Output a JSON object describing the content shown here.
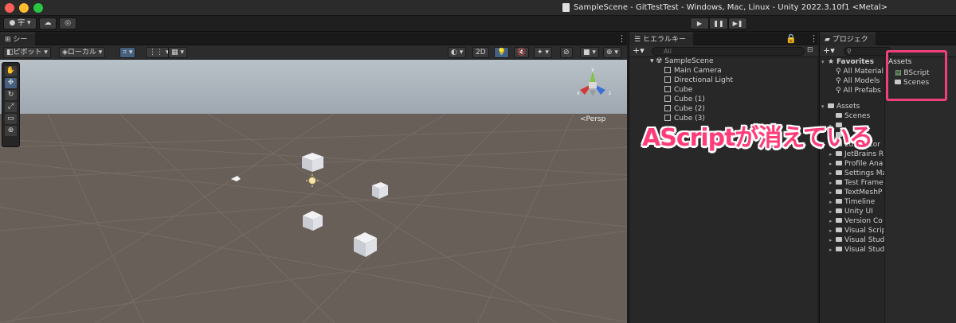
{
  "window": {
    "title": "SampleScene - GitTestTest - Windows, Mac, Linux - Unity 2022.3.10f1 <Metal>"
  },
  "toolbar": {
    "account_label": "宇 ▾",
    "play_icon": "play-icon",
    "pause_icon": "pause-icon",
    "step_icon": "step-icon"
  },
  "scene": {
    "tab_label": "シーン",
    "pivot_label": "ピボット",
    "local_label": "ローカル",
    "mode_2d": "2D",
    "persp_label": "<Persp",
    "gizmo_axes": [
      "x",
      "y",
      "z"
    ]
  },
  "hierarchy": {
    "tab_label": "ヒエラルキー",
    "search_placeholder": "All",
    "scene_name": "SampleScene",
    "items": [
      "Main Camera",
      "Directional Light",
      "Cube",
      "Cube (1)",
      "Cube (2)",
      "Cube (3)"
    ]
  },
  "project": {
    "tab_label": "プロジェクト",
    "favorites_label": "Favorites",
    "favorites": [
      "All Material",
      "All Models",
      "All Prefabs"
    ],
    "assets_label": "Assets",
    "asset_folders": [
      "Scenes",
      "",
      "",
      "Editor Cor",
      "JetBrains R",
      "Profile Ana",
      "Settings Ma",
      "Test Frame",
      "TextMeshP",
      "Timeline",
      "Unity UI",
      "Version Co",
      "Visual Scrip",
      "Visual Stud",
      "Visual Stud"
    ],
    "content_header": "Assets",
    "content_items": [
      "BScript",
      "Scenes"
    ]
  },
  "annotation": {
    "text": "AScriptが消えている",
    "color": "#ff3c78"
  },
  "colors": {
    "sky": "#b9c1c8",
    "ground": "#685f58",
    "highlight": "#f0407a"
  }
}
